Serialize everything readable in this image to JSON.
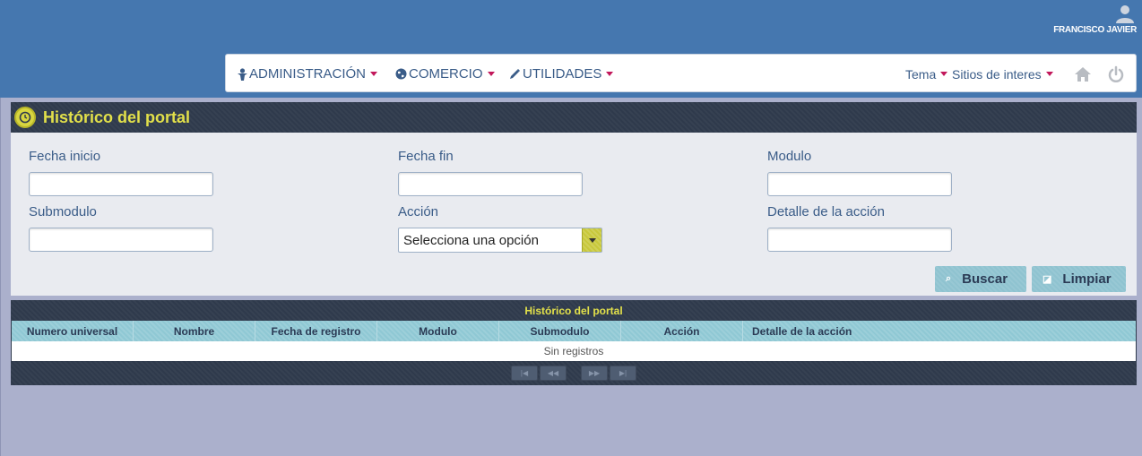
{
  "user": {
    "name": "FRANCISCO JAVIER",
    "icon": "user-icon"
  },
  "nav": {
    "items": [
      {
        "label": "ADMINISTRACIÓN",
        "icon": "user-tie-icon"
      },
      {
        "label": "COMERCIO",
        "icon": "globe-icon"
      },
      {
        "label": "UTILIDADES",
        "icon": "pencil-icon"
      }
    ],
    "right": [
      {
        "label": "Tema"
      },
      {
        "label": "Sitios de interes"
      }
    ],
    "home_icon": "home-icon",
    "power_icon": "power-icon"
  },
  "panel": {
    "title": "Histórico del portal",
    "fields": {
      "fecha_inicio": {
        "label": "Fecha inicio",
        "value": ""
      },
      "fecha_fin": {
        "label": "Fecha fin",
        "value": ""
      },
      "modulo": {
        "label": "Modulo",
        "value": ""
      },
      "submodulo": {
        "label": "Submodulo",
        "value": ""
      },
      "accion": {
        "label": "Acción",
        "selected": "Selecciona una opción"
      },
      "detalle": {
        "label": "Detalle de la acción",
        "value": ""
      }
    },
    "buttons": {
      "search": "Buscar",
      "clear": "Limpiar"
    }
  },
  "grid": {
    "caption": "Histórico del portal",
    "columns": [
      "Numero universal",
      "Nombre",
      "Fecha de registro",
      "Modulo",
      "Submodulo",
      "Acción",
      "Detalle de la acción"
    ],
    "empty_message": "Sin registros",
    "pager": [
      "|◀",
      "◀◀",
      "▶▶",
      "▶|"
    ]
  },
  "colors": {
    "header_blue": "#4577af",
    "panel_dark": "#2f3a4c",
    "title_yellow": "#e2e04a",
    "button_teal": "#8fc3d0",
    "caret_red": "#c2185b"
  }
}
